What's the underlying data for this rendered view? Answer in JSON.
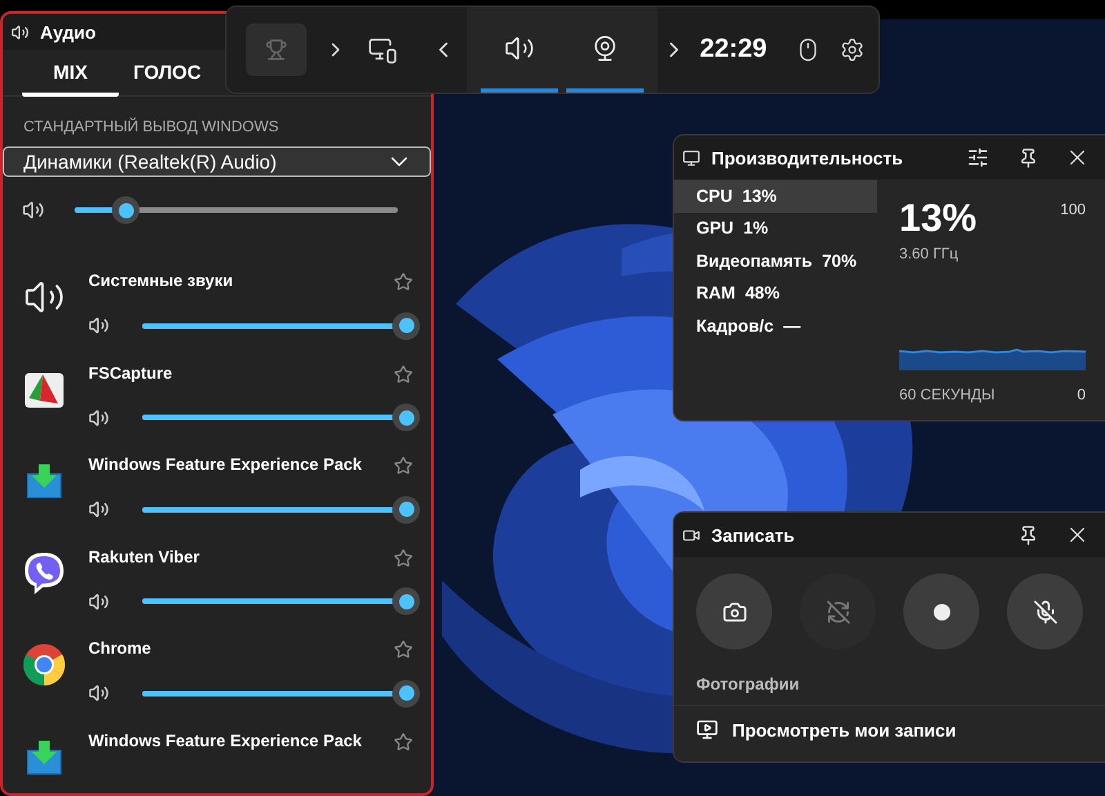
{
  "topbar": {
    "widgets": [
      {
        "kind": "achievements",
        "disabled": true
      },
      {
        "kind": "more"
      },
      {
        "kind": "overlay"
      }
    ],
    "pinned": [
      {
        "kind": "audio",
        "active": true
      },
      {
        "kind": "capture",
        "active": true
      }
    ],
    "time": "22:29"
  },
  "audio": {
    "title": "Аудио",
    "tabs": [
      {
        "label": "MIX",
        "selected": true
      },
      {
        "label": "ГОЛОС",
        "selected": false
      }
    ],
    "section": "СТАНДАРТНЫЙ ВЫВОД WINDOWS",
    "device": "Динамики (Realtek(R) Audio)",
    "master": {
      "level": 0.16
    },
    "apps": [
      {
        "name": "Системные звуки",
        "kind": "speaker",
        "favorite": false,
        "level": 1
      },
      {
        "name": "FSCapture",
        "kind": "fscapture",
        "favorite": false,
        "level": 1
      },
      {
        "name": "Windows Feature Experience Pack",
        "kind": "download",
        "favorite": false,
        "level": 1
      },
      {
        "name": "Rakuten Viber",
        "kind": "viber",
        "favorite": false,
        "level": 1
      },
      {
        "name": "Chrome",
        "kind": "chrome",
        "favorite": false,
        "level": 1
      },
      {
        "name": "Windows Feature Experience Pack",
        "kind": "download",
        "favorite": false
      }
    ]
  },
  "performance": {
    "title": "Производительность",
    "metrics": [
      {
        "label": "CPU",
        "value": "13%",
        "selected": true
      },
      {
        "label": "GPU",
        "value": "1%",
        "selected": false
      },
      {
        "label": "Видеопамять",
        "value": "70%",
        "selected": false
      },
      {
        "label": "RAM",
        "value": "48%",
        "selected": false
      },
      {
        "label": "Кадров/с",
        "value": "—",
        "selected": false
      }
    ],
    "big_value": "13%",
    "frequency": "3.60 ГГц",
    "axis_max": "100",
    "axis_min": "0",
    "time_span": "60 СЕКУНДЫ"
  },
  "capture": {
    "title": "Записать",
    "buttons": [
      {
        "kind": "screenshot",
        "disabled": false
      },
      {
        "kind": "replay",
        "disabled": true
      },
      {
        "kind": "record",
        "disabled": false
      },
      {
        "kind": "mic",
        "disabled": false
      }
    ],
    "caption": "Фотографии",
    "link": "Просмотреть мои записи"
  }
}
